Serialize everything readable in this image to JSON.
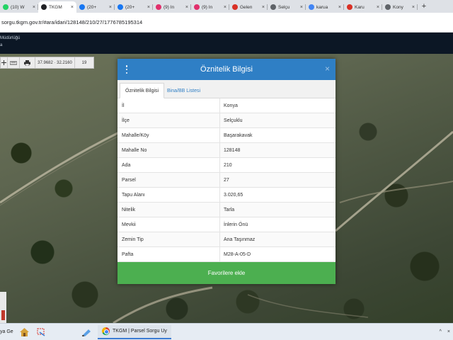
{
  "browser": {
    "tabs": [
      {
        "label": "(10) W",
        "icon": "whatsapp-icon",
        "color": "#25d366",
        "active": false
      },
      {
        "label": "TKGM",
        "icon": "location-pin-icon",
        "color": "#202124",
        "active": true
      },
      {
        "label": "(20+",
        "icon": "facebook-icon",
        "color": "#1877f2",
        "active": false
      },
      {
        "label": "(20+",
        "icon": "facebook-icon",
        "color": "#1877f2",
        "active": false
      },
      {
        "label": "(9) In",
        "icon": "instagram-icon",
        "color": "#e1306c",
        "active": false
      },
      {
        "label": "(9) In",
        "icon": "instagram-icon",
        "color": "#e1306c",
        "active": false
      },
      {
        "label": "Gelen",
        "icon": "gmail-icon",
        "color": "#d93025",
        "active": false
      },
      {
        "label": "Selçu",
        "icon": "google-search-icon",
        "color": "#5f6368",
        "active": false
      },
      {
        "label": "karua",
        "icon": "google-icon",
        "color": "#4285f4",
        "active": false
      },
      {
        "label": "Karu",
        "icon": "karu-icon",
        "color": "#d93025",
        "active": false
      },
      {
        "label": "Kony",
        "icon": "globe-icon",
        "color": "#5f6368",
        "active": false
      }
    ],
    "new_tab_label": "+",
    "address": "sorgu.tkgm.gov.tr/#ara/idari/128148/210/27/1776785195314"
  },
  "site": {
    "header_line1": "Müdürlüğü",
    "header_line2": "a"
  },
  "map_toolbar": {
    "items": [
      "",
      "",
      "",
      "37.9682 · 32.2160",
      "19"
    ]
  },
  "dialog": {
    "title": "Öznitelik Bilgisi",
    "close_label": "×",
    "tabs": [
      "Öznitelik Bilgisi",
      "Bina/BB Listesi"
    ],
    "rows": [
      {
        "key": "İl",
        "value": "Konya"
      },
      {
        "key": "İlçe",
        "value": "Selçuklu"
      },
      {
        "key": "Mahalle/Köy",
        "value": "Başarakavak"
      },
      {
        "key": "Mahalle No",
        "value": "128148"
      },
      {
        "key": "Ada",
        "value": "210"
      },
      {
        "key": "Parsel",
        "value": "27"
      },
      {
        "key": "Tapu Alanı",
        "value": "3.020,65"
      },
      {
        "key": "Nitelik",
        "value": "Tarla"
      },
      {
        "key": "Mevkii",
        "value": "İnlerin Önü"
      },
      {
        "key": "Zemin Tip",
        "value": "Ana Taşınmaz"
      },
      {
        "key": "Pafta",
        "value": "M28-A-05-D"
      }
    ],
    "favorite_button": "Favorilere ekle",
    "header_color": "#2f7fc5",
    "button_color": "#4caf50"
  },
  "taskbar": {
    "left_text": "ya Ge",
    "app_label": "TKGM | Parsel Sorgu Uy",
    "tray_chevron": "^",
    "tray_close": "×"
  }
}
